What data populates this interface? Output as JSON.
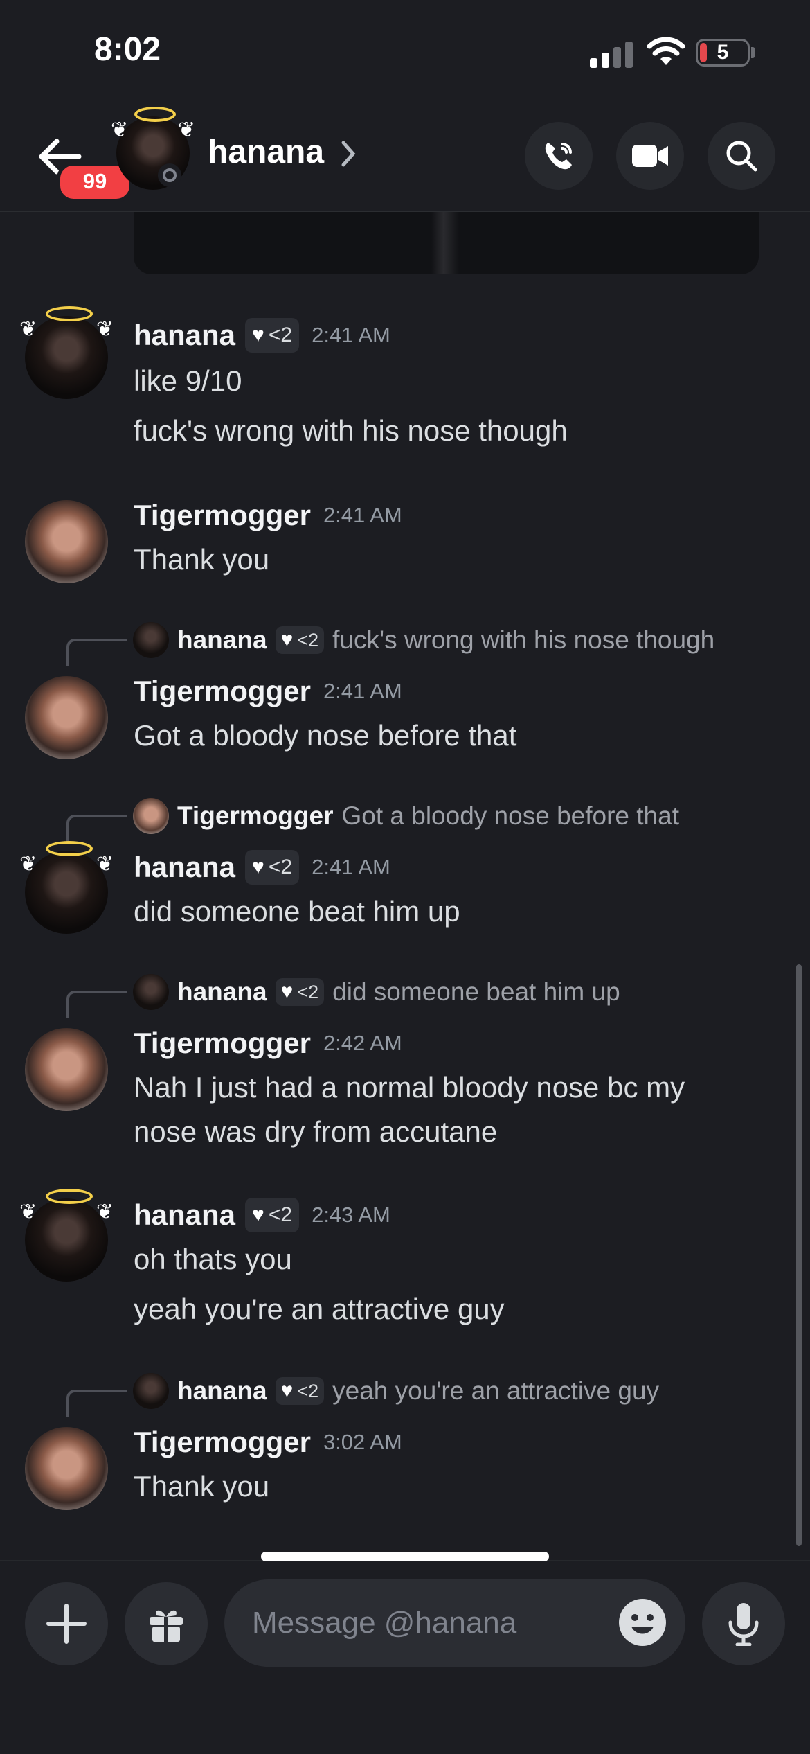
{
  "status_bar": {
    "time": "8:02",
    "battery": "5"
  },
  "header": {
    "unread_count": "99",
    "channel_name": "hanana"
  },
  "composer": {
    "placeholder": "Message @hanana"
  },
  "messages": [
    {
      "author": "hanana",
      "tag": "<2",
      "time": "2:41 AM",
      "lines": [
        "like 9/10",
        "fuck's wrong with his nose though"
      ]
    },
    {
      "author": "Tigermogger",
      "time": "2:41 AM",
      "lines": [
        "Thank you"
      ]
    },
    {
      "reply": {
        "author": "hanana",
        "tag": "<2",
        "text": "fuck's wrong with his nose though"
      },
      "author": "Tigermogger",
      "time": "2:41 AM",
      "lines": [
        "Got a bloody nose before that"
      ]
    },
    {
      "reply": {
        "author": "Tigermogger",
        "text": "Got a bloody nose before that"
      },
      "author": "hanana",
      "tag": "<2",
      "time": "2:41 AM",
      "lines": [
        "did someone beat him up"
      ]
    },
    {
      "reply": {
        "author": "hanana",
        "tag": "<2",
        "text": "did someone beat him up"
      },
      "author": "Tigermogger",
      "time": "2:42 AM",
      "lines": [
        "Nah I just had a normal bloody nose bc my",
        "nose was dry from accutane"
      ]
    },
    {
      "author": "hanana",
      "tag": "<2",
      "time": "2:43 AM",
      "lines": [
        "oh thats you",
        "yeah you're an attractive guy"
      ]
    },
    {
      "reply": {
        "author": "hanana",
        "tag": "<2",
        "text": "yeah you're an attractive guy"
      },
      "author": "Tigermogger",
      "time": "3:02 AM",
      "lines": [
        "Thank you"
      ]
    }
  ]
}
